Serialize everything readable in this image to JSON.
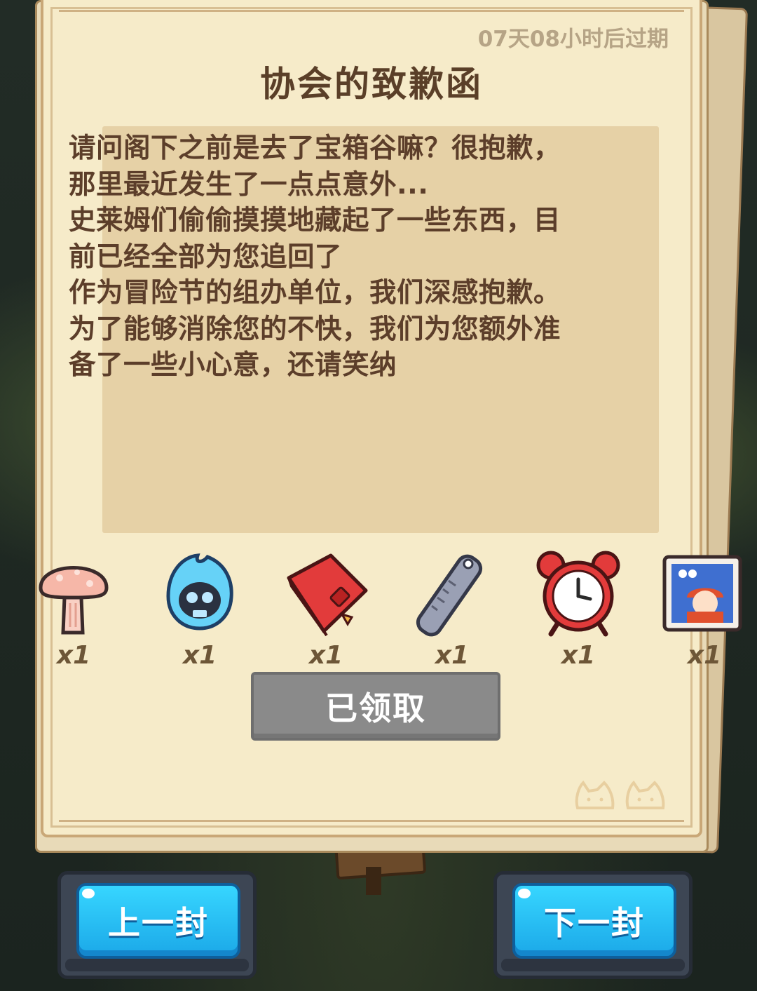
{
  "letter": {
    "expiry": "07天08小时后过期",
    "title": "协会的致歉函",
    "body": "请问阁下之前是去了宝箱谷嘛？很抱歉，\n那里最近发生了一点点意外...\n史莱姆们偷偷摸摸地藏起了一些东西，目\n前已经全部为您追回了\n作为冒险节的组办单位，我们深感抱歉。\n为了能够消除您的不快，我们为您额外准\n备了一些小心意，还请笑纳"
  },
  "rewards": [
    {
      "icon": "mushroom-icon",
      "qty": "x1"
    },
    {
      "icon": "blue-flame-skull-icon",
      "qty": "x1"
    },
    {
      "icon": "red-book-icon",
      "qty": "x1"
    },
    {
      "icon": "ruler-icon",
      "qty": "x1"
    },
    {
      "icon": "alarm-clock-icon",
      "qty": "x1"
    },
    {
      "icon": "portrait-card-icon",
      "qty": "x1"
    }
  ],
  "claim_button": {
    "label": "已领取"
  },
  "nav": {
    "prev_label": "上一封",
    "next_label": "下一封"
  },
  "colors": {
    "paper": "#f6ebc9",
    "body_box": "#e6d1a6",
    "text_brown": "#5c3e2a",
    "claimed_gray": "#8a8a8a",
    "nav_blue": "#1ba8e8"
  }
}
